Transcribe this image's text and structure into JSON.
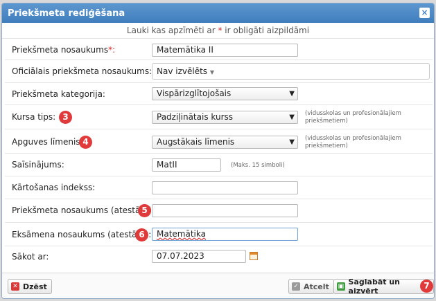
{
  "dialog": {
    "title": "Priekšmeta rediģēšana",
    "close_glyph": "×"
  },
  "notice": {
    "before": "Lauki kas apzīmēti ar ",
    "star": "*",
    "after": " ir obligāti aizpildāmi"
  },
  "fields": {
    "name": {
      "label": "Priekšmeta nosaukums",
      "required_mark": "*:",
      "value": "Matemātika II"
    },
    "official": {
      "label": "Oficiālais priekšmeta nosaukums:",
      "value": "Nav izvēlēts"
    },
    "category": {
      "label": "Priekšmeta kategorija:",
      "value": "Vispārizglītojošais"
    },
    "course_type": {
      "label": "Kursa tips:",
      "value": "Padziļinātais kurss",
      "hint": "(vidusskolas un profesionālajiem priekšmetiem)",
      "badge": "3"
    },
    "level": {
      "label": "Apguves līmenis:",
      "value": "Augstākais līmenis",
      "hint": "(vidusskolas un profesionālajiem priekšmetiem)",
      "badge": "4"
    },
    "abbr": {
      "label": "Saīsinājums:",
      "value": "MatII",
      "hint": "(Maks. 15 simboli)"
    },
    "sort_index": {
      "label": "Kārtošanas indekss:",
      "value": ""
    },
    "cert_name": {
      "label": "Priekšmeta nosaukums (atestātā):",
      "value": "",
      "badge": "5"
    },
    "exam_name": {
      "label": "Eksāmena nosaukums (atestātā):",
      "value": "Matemātika",
      "badge": "6"
    },
    "start": {
      "label": "Sākot ar:",
      "value": "07.07.2023"
    }
  },
  "footer": {
    "delete_label": "Dzēst",
    "cancel_label": "Atcelt",
    "save_label": "Saglabāt un aizvērt",
    "save_badge": "7"
  },
  "colors": {
    "titlebar": "#4a86c4",
    "badge": "#e03a3a",
    "required": "#dd2222"
  }
}
